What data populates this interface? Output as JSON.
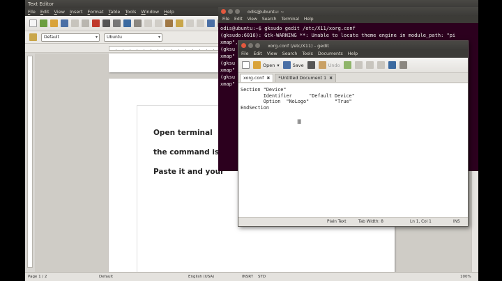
{
  "writer": {
    "title": "Text Editor",
    "menu": [
      "File",
      "Edit",
      "View",
      "Insert",
      "Format",
      "Table",
      "Tools",
      "Window",
      "Help"
    ],
    "style_value": "Default",
    "font_value": "Ubuntu",
    "doc_lines": [
      "Open terminal",
      "the command is in",
      "Paste it and your"
    ],
    "status": {
      "page": "Page 1 / 2",
      "style": "Default",
      "language": "English (USA)",
      "insert": "INSRT",
      "std": "STD",
      "zoom": "100%"
    }
  },
  "terminal": {
    "title": "odis@ubuntu: ~",
    "menu": [
      "File",
      "Edit",
      "View",
      "Search",
      "Terminal",
      "Help"
    ],
    "lines": [
      "odis@ubuntu:~$ gksudo gedit /etc/X11/xorg.conf",
      "",
      "(gksudo:6016): Gtk-WARNING **: Unable to locate theme engine in module_path: \"pi",
      "xmap\",",
      "",
      "(gksu",
      "xmap\"",
      "",
      "(gksu",
      "xmap\"",
      "",
      "(gksu",
      "xmap\""
    ]
  },
  "gedit": {
    "title": "xorg.conf (/etc/X11) - gedit",
    "menu": [
      "File",
      "Edit",
      "View",
      "Search",
      "Tools",
      "Documents",
      "Help"
    ],
    "toolbar": {
      "open": "Open",
      "save": "Save",
      "undo": "Undo"
    },
    "tabs": [
      {
        "label": "xorg.conf",
        "active": true
      },
      {
        "label": "*Untitled Document 1",
        "active": false
      }
    ],
    "content": "Section \"Device\"\n        Identifier      \"Default Device\"\n        Option  \"NoLogo\"         \"True\"\nEndSection",
    "status": {
      "language": "Plain Text",
      "tab_width": "Tab Width: 8",
      "position": "Ln 1, Col 1",
      "mode": "INS"
    }
  },
  "colors": {
    "terminal_bg": "#2c001e",
    "titlebar": "#3c3b37",
    "close_button": "#e2583e"
  }
}
